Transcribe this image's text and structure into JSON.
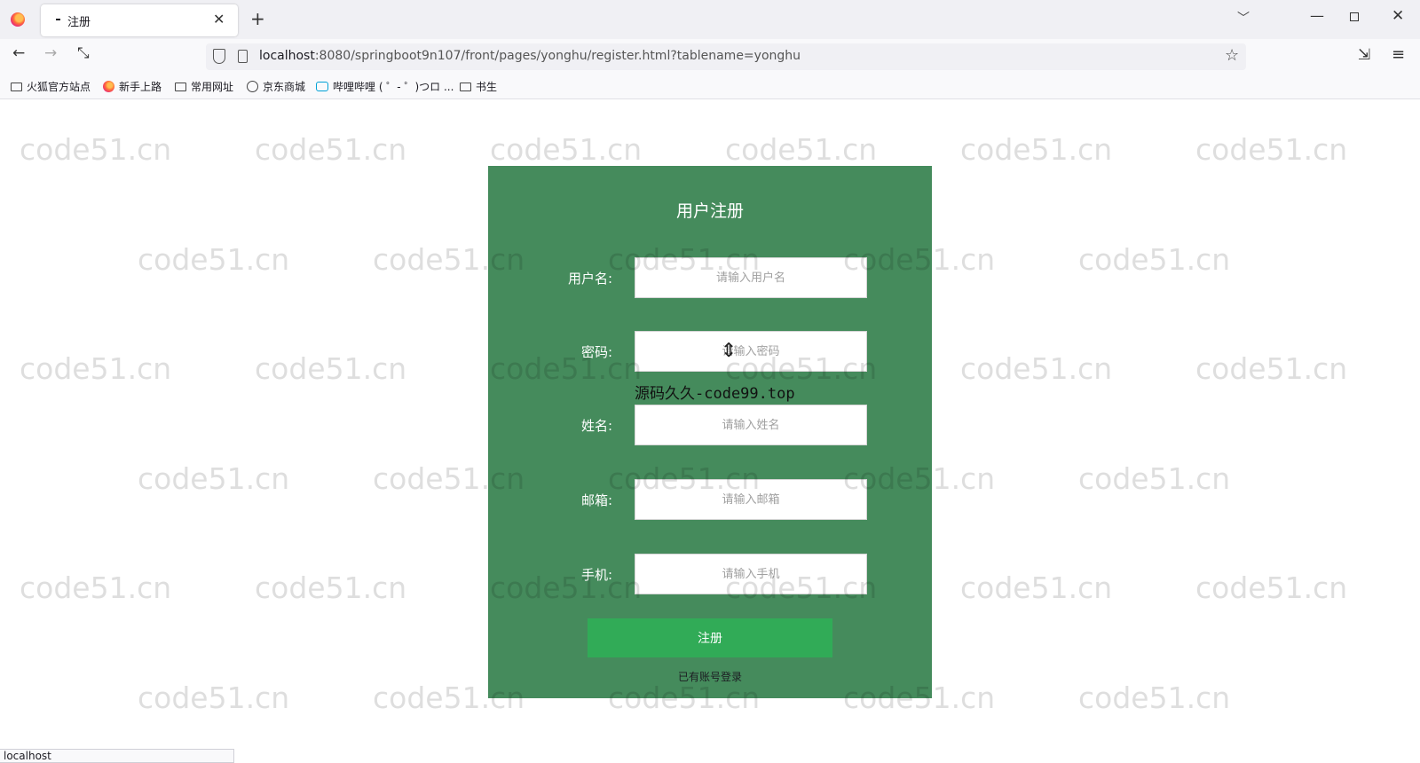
{
  "browser": {
    "tab": {
      "title": "注册",
      "close": "✕"
    },
    "new_tab": "+",
    "tab_list": "﹀",
    "window": {
      "minimize": "—",
      "close": "✕"
    },
    "nav": {
      "back": "←",
      "forward": "→",
      "reload": "⤡"
    },
    "url": {
      "host": "localhost",
      "rest": ":8080/springboot9n107/front/pages/yonghu/register.html?tablename=yonghu"
    },
    "star": "☆",
    "ext": "⇲",
    "menu": "≡",
    "bookmarks": [
      "火狐官方站点",
      "新手上路",
      "常用网址",
      "京东商城",
      "哔哩哔哩 ( ゜- ゜)つロ ...",
      "书生"
    ]
  },
  "watermark": "code51.cn",
  "form": {
    "title": "用户注册",
    "fields": [
      {
        "label": "用户名:",
        "placeholder": "请输入用户名"
      },
      {
        "label": "密码:",
        "placeholder": "请输入密码"
      },
      {
        "label": "姓名:",
        "placeholder": "请输入姓名"
      },
      {
        "label": "邮箱:",
        "placeholder": "请输入邮箱"
      },
      {
        "label": "手机:",
        "placeholder": "请输入手机"
      }
    ],
    "submit": "注册",
    "login_link": "已有账号登录"
  },
  "overlay": "源码久久-code99.top",
  "cursor": "⇕",
  "status": "localhost"
}
